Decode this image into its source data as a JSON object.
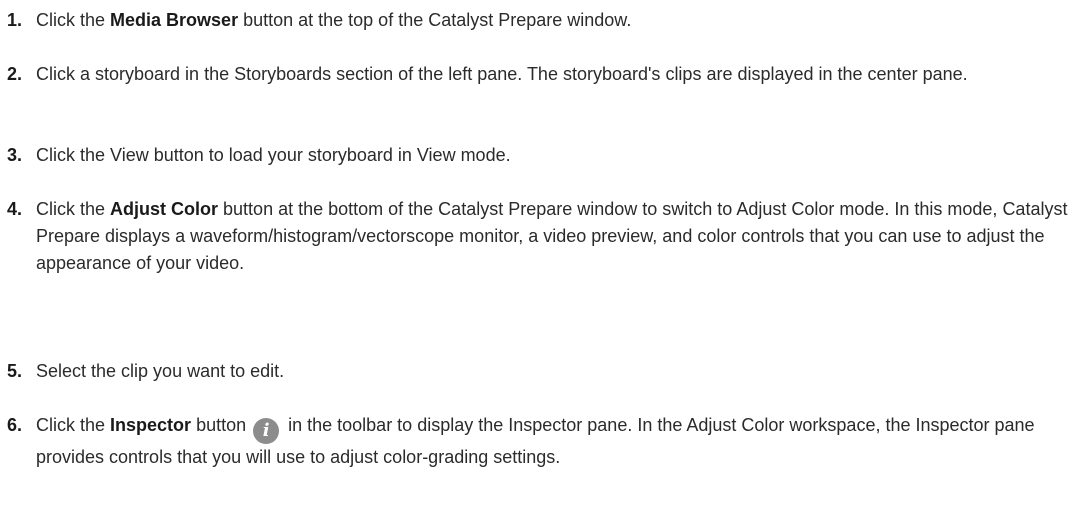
{
  "steps": [
    {
      "number": "1.",
      "text_before": "Click the ",
      "ui_term": "Media Browser",
      "text_after": " button at the top of the Catalyst Prepare window."
    },
    {
      "number": "2.",
      "text": "Click a storyboard in the Storyboards section of the left pane. The storyboard's clips are displayed in the center pane."
    },
    {
      "number": "3.",
      "text": "Click the View button to load your storyboard in View mode."
    },
    {
      "number": "4.",
      "text_before": "Click the ",
      "ui_term": "Adjust Color",
      "text_after": " button at the bottom of the Catalyst Prepare window to switch to Adjust Color mode. In this mode, Catalyst Prepare displays a waveform/histogram/vectorscope monitor, a video preview, and color controls that you can use to adjust the appearance of your video."
    },
    {
      "number": "5.",
      "text": "Select the clip you want to edit."
    },
    {
      "number": "6.",
      "text_before": "Click the ",
      "ui_term": "Inspector",
      "text_middle": " button ",
      "icon_name": "info-icon",
      "icon_glyph": "i",
      "text_after": " in the toolbar to display the Inspector pane. In the Adjust Color workspace, the Inspector pane provides controls that you will use to adjust color-grading settings."
    }
  ]
}
